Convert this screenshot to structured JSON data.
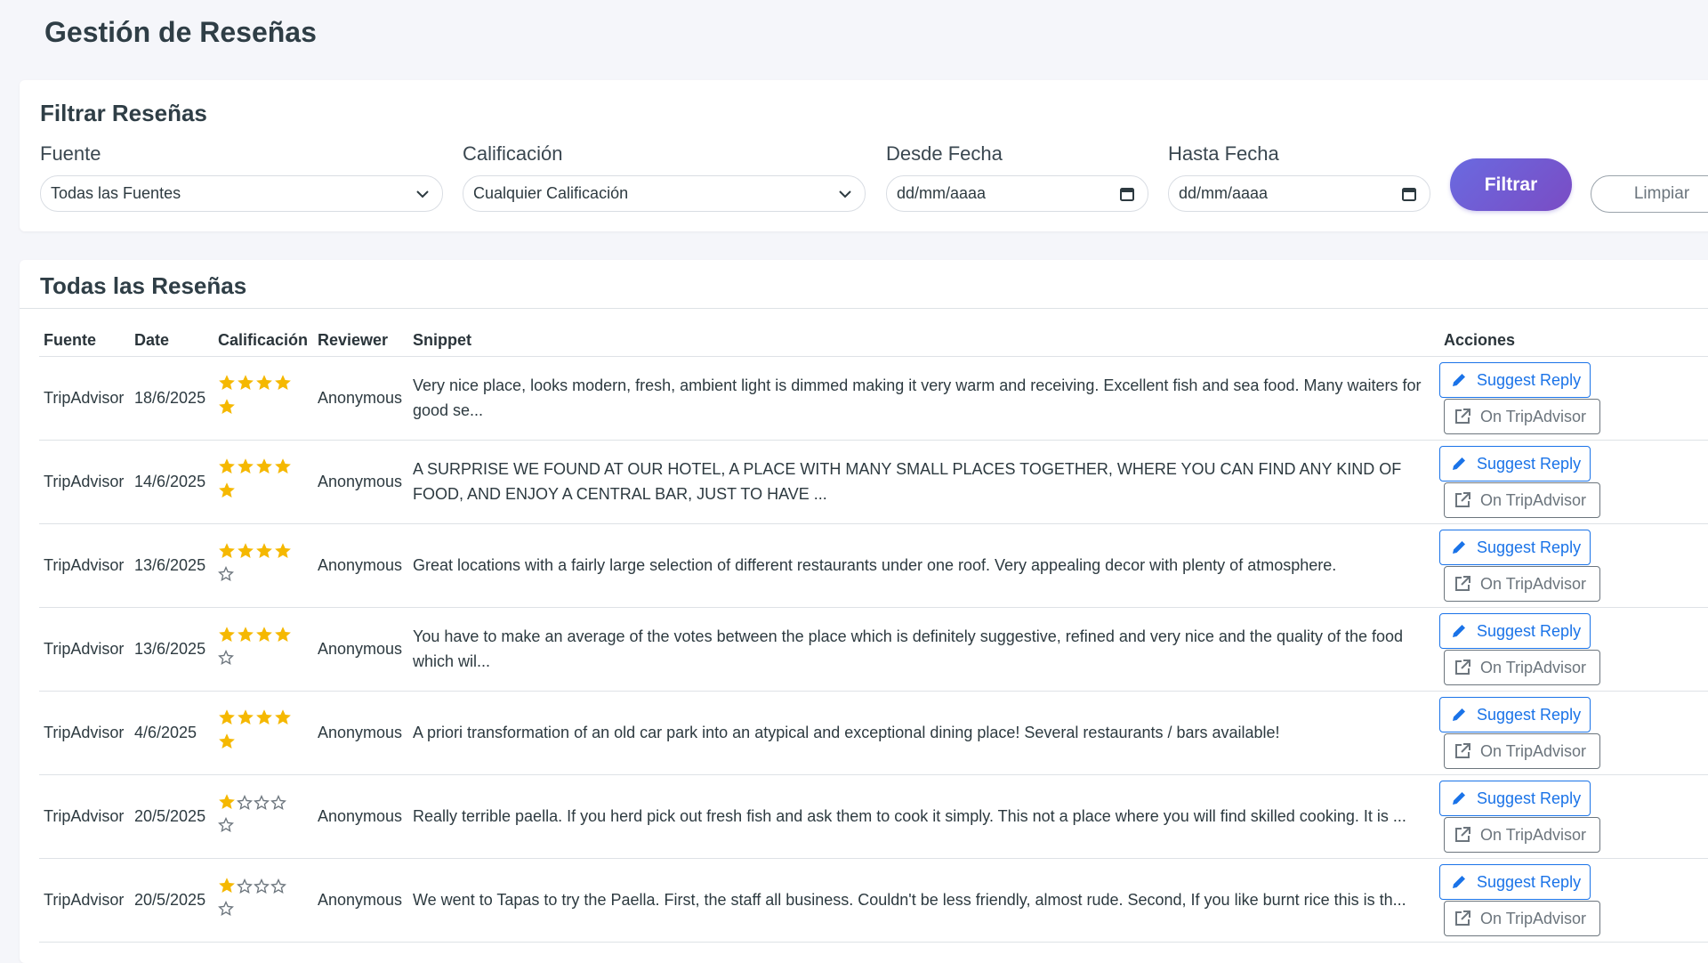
{
  "page": {
    "title": "Gestión de Reseñas"
  },
  "filters": {
    "title": "Filtrar Reseñas",
    "source_label": "Fuente",
    "source_value": "Todas las Fuentes",
    "rating_label": "Calificación",
    "rating_value": "Cualquier Calificación",
    "from_label": "Desde Fecha",
    "from_placeholder": "dd/mm/aaaa",
    "to_label": "Hasta Fecha",
    "to_placeholder": "dd/mm/aaaa",
    "filter_button": "Filtrar",
    "clear_button": "Limpiar"
  },
  "reviews": {
    "title": "Todas las Reseñas",
    "columns": [
      "Fuente",
      "Date",
      "Calificación",
      "Reviewer",
      "Snippet",
      "Acciones"
    ],
    "suggest_label": "Suggest Reply",
    "external_label": "On TripAdvisor",
    "colors": {
      "star": "#f5b800",
      "empty_star": "#6c757d",
      "primary": "#1a73e8",
      "secondary": "#6c757d"
    },
    "rows": [
      {
        "source": "TripAdvisor",
        "date": "18/6/2025",
        "rating": 5,
        "reviewer": "Anonymous",
        "snippet": "Very nice place, looks modern, fresh, ambient light is dimmed making it very warm and receiving. Excellent fish and sea food. Many waiters for good se..."
      },
      {
        "source": "TripAdvisor",
        "date": "14/6/2025",
        "rating": 5,
        "reviewer": "Anonymous",
        "snippet": "A SURPRISE WE FOUND AT OUR HOTEL, A PLACE WITH MANY SMALL PLACES TOGETHER, WHERE YOU CAN FIND ANY KIND OF FOOD, AND ENJOY A CENTRAL BAR, JUST TO HAVE ..."
      },
      {
        "source": "TripAdvisor",
        "date": "13/6/2025",
        "rating": 4,
        "reviewer": "Anonymous",
        "snippet": "Great locations with a fairly large selection of different restaurants under one roof. Very appealing decor with plenty of atmosphere."
      },
      {
        "source": "TripAdvisor",
        "date": "13/6/2025",
        "rating": 4,
        "reviewer": "Anonymous",
        "snippet": "You have to make an average of the votes between the place which is definitely suggestive, refined and very nice and the quality of the food which wil..."
      },
      {
        "source": "TripAdvisor",
        "date": "4/6/2025",
        "rating": 5,
        "reviewer": "Anonymous",
        "snippet": "A priori transformation of an old car park into an atypical and exceptional dining place! Several restaurants / bars available!"
      },
      {
        "source": "TripAdvisor",
        "date": "20/5/2025",
        "rating": 1,
        "reviewer": "Anonymous",
        "snippet": "Really terrible paella. If you herd pick out fresh fish and ask them to cook it simply. This not a place where you will find skilled cooking. It is ..."
      },
      {
        "source": "TripAdvisor",
        "date": "20/5/2025",
        "rating": 1,
        "reviewer": "Anonymous",
        "snippet": "We went to Tapas to try the Paella. First, the staff all business. Couldn't be less friendly, almost rude. Second, If you like burnt rice this is th..."
      }
    ]
  }
}
